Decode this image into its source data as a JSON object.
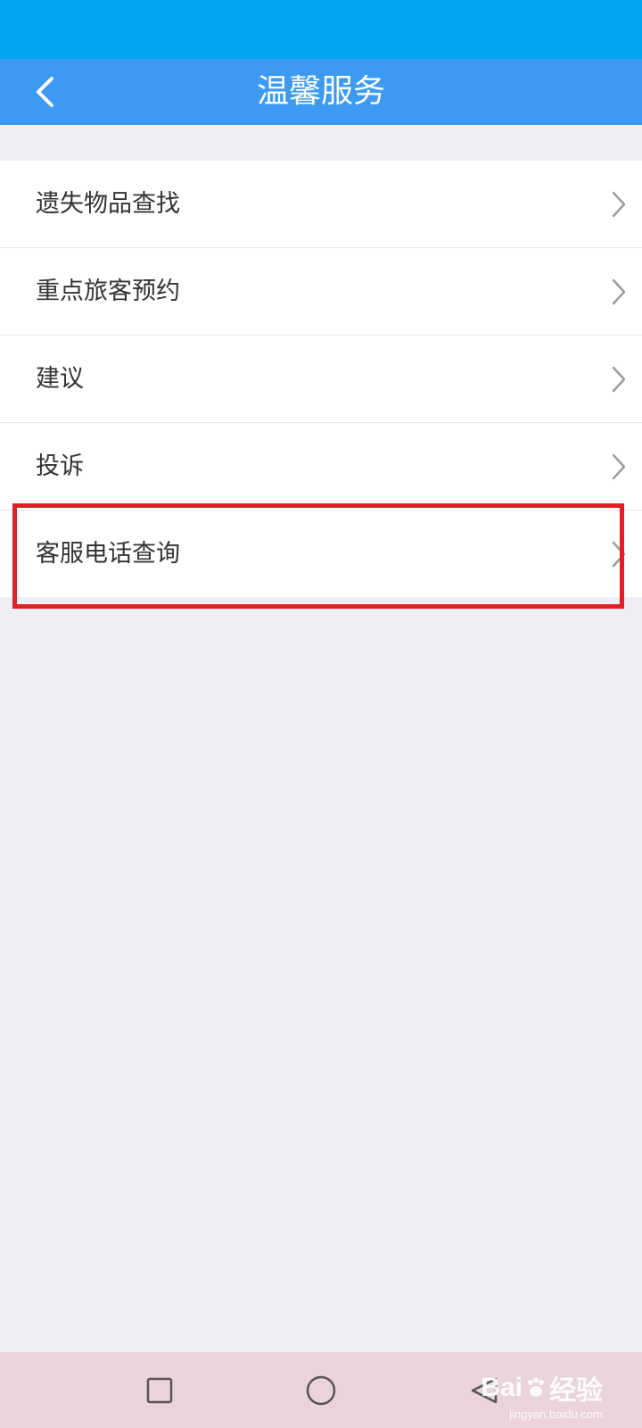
{
  "header": {
    "title": "温馨服务",
    "back_icon": "chevron-left-icon",
    "status_bar_color": "#00a6f0",
    "title_bar_color": "#3c9af3"
  },
  "menu": {
    "items": [
      {
        "label": "遗失物品查找"
      },
      {
        "label": "重点旅客预约"
      },
      {
        "label": "建议"
      },
      {
        "label": "投诉"
      },
      {
        "label": "客服电话查询"
      }
    ],
    "highlighted_item": "客服电话查询",
    "highlight_color": "#e31e25"
  },
  "nav": {
    "buttons": [
      "square-icon",
      "circle-icon",
      "triangle-back-icon"
    ]
  },
  "watermark": {
    "brand": "Bai",
    "brand_suffix": "经验",
    "url": "jingyan.baidu.com"
  }
}
